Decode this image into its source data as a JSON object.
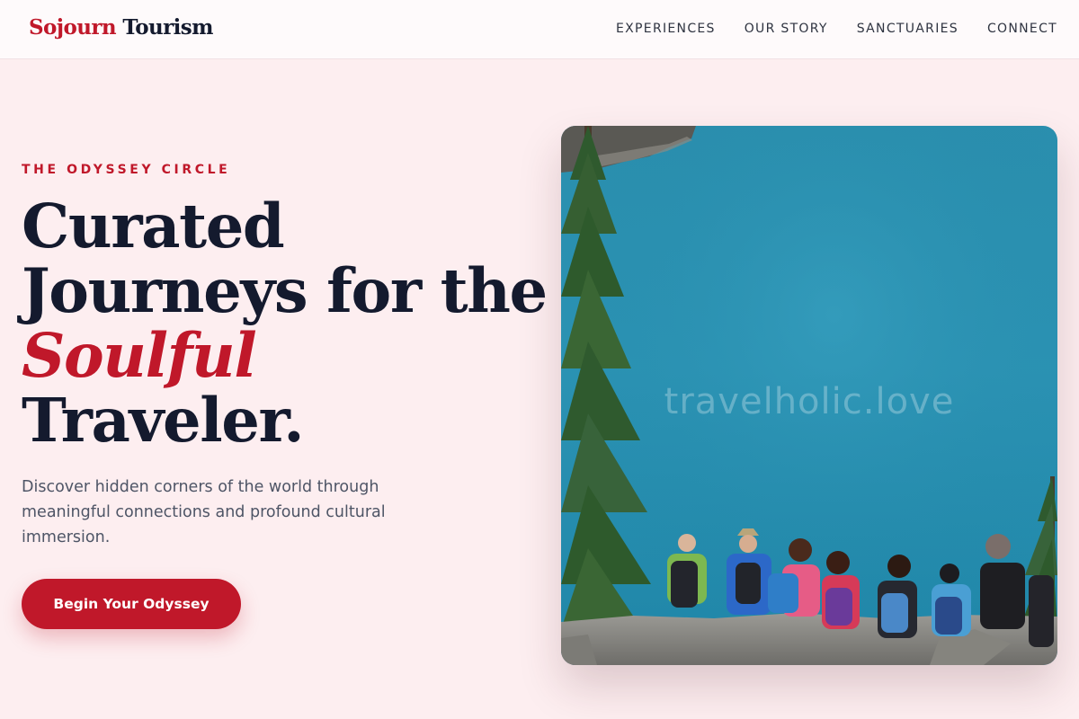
{
  "brand": {
    "first": "Sojourn",
    "second": " Tourism"
  },
  "nav": {
    "items": [
      {
        "label": "EXPERIENCES"
      },
      {
        "label": "OUR STORY"
      },
      {
        "label": "SANCTUARIES"
      },
      {
        "label": "CONNECT"
      }
    ]
  },
  "hero": {
    "eyebrow": "THE ODYSSEY CIRCLE",
    "headline": {
      "line1": "Curated",
      "line2": "Journeys for the",
      "accent": "Soulful",
      "line4": "Traveler."
    },
    "lede": "Discover hidden corners of the world through meaningful connections and profound cultural immersion.",
    "cta_label": "Begin Your Odyssey",
    "image": {
      "watermark": "travelholic.love"
    }
  },
  "colors": {
    "accent": "#c0182a",
    "ink": "#141a2e",
    "background": "#fdeef0",
    "lake": "#2a94b6"
  }
}
